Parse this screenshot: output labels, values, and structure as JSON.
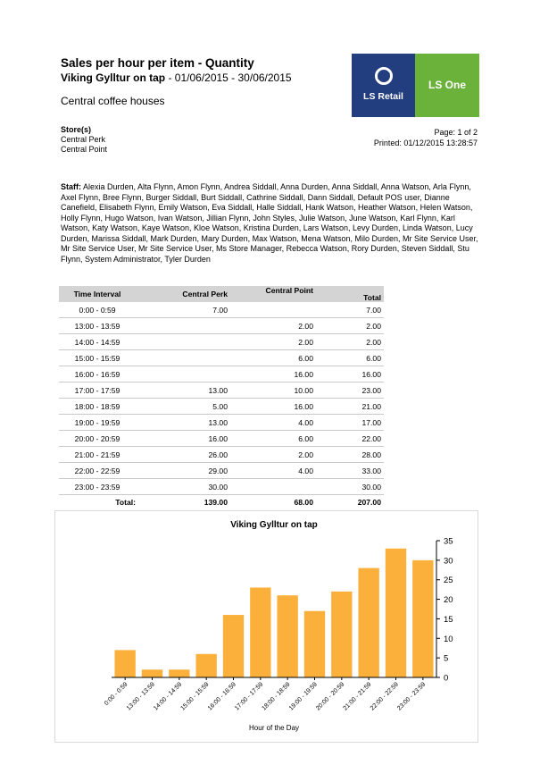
{
  "report": {
    "title": "Sales per hour per item - Quantity",
    "item": "Viking Gylltur on tap",
    "date_range": " - 01/06/2015 - 30/06/2015",
    "company": "Central coffee houses"
  },
  "logo": {
    "left_text": "LS Retail",
    "right_text": "LS One"
  },
  "stores": {
    "heading": "Store(s)",
    "items": [
      "Central Perk",
      "Central Point"
    ]
  },
  "page_info": {
    "page": "Page: 1 of 2",
    "printed": "Printed: 01/12/2015 13:28:57"
  },
  "staff": {
    "label": "Staff:",
    "text": " Alexia Durden, Alta Flynn, Amon Flynn, Andrea Siddall, Anna Durden, Anna Siddall, Anna Watson, Arla Flynn, Axel Flynn, Bree Flynn, Burger Siddall, Burt Siddall, Cathrine Siddall, Dann Siddall, Default POS user, Dianne Canefield, Elisabeth Flynn, Emily Watson, Eva Siddall, Halle Siddall, Hank Watson, Heather Watson, Helen Watson, Holly Flynn, Hugo Watson, Ivan Watson, Jillian Flynn, John Styles, Julie Watson, June Watson, Karl Flynn, Karl Watson, Katy Watson, Kaye Watson, Kloe Watson, Kristina Durden, Lars Watson, Levy Durden, Linda Watson, Lucy Durden, Marissa Siddall, Mark Durden, Mary Durden, Max Watson, Mena Watson, Milo Durden, Mr Site  Service User, Mr Site Service User, Mr Site Service User, Ms Store Manager, Rebecca Watson, Rory Durden, Steven Siddall, Stu Flynn, System Administrator, Tyler Durden"
  },
  "table": {
    "headers": [
      "Time Interval",
      "Central Perk",
      "Central Point",
      "Total"
    ],
    "rows": [
      [
        "0:00 - 0:59",
        "7.00",
        "",
        "7.00"
      ],
      [
        "13:00 - 13:59",
        "",
        "2.00",
        "2.00"
      ],
      [
        "14:00 - 14:59",
        "",
        "2.00",
        "2.00"
      ],
      [
        "15:00 - 15:59",
        "",
        "6.00",
        "6.00"
      ],
      [
        "16:00 - 16:59",
        "",
        "16.00",
        "16.00"
      ],
      [
        "17:00 - 17:59",
        "13.00",
        "10.00",
        "23.00"
      ],
      [
        "18:00 - 18:59",
        "5.00",
        "16.00",
        "21.00"
      ],
      [
        "19:00 - 19:59",
        "13.00",
        "4.00",
        "17.00"
      ],
      [
        "20:00 - 20:59",
        "16.00",
        "6.00",
        "22.00"
      ],
      [
        "21:00 - 21:59",
        "26.00",
        "2.00",
        "28.00"
      ],
      [
        "22:00 - 22:59",
        "29.00",
        "4.00",
        "33.00"
      ],
      [
        "23:00 - 23:59",
        "30.00",
        "",
        "30.00"
      ]
    ],
    "totals": [
      "Total:",
      "139.00",
      "68.00",
      "207.00"
    ]
  },
  "chart_data": {
    "type": "bar",
    "title": "Viking Gylltur on tap",
    "xlabel": "Hour of the Day",
    "ylabel": "",
    "categories": [
      "0:00 - 0:59",
      "13:00 - 13:59",
      "14:00 - 14:59",
      "15:00 - 15:59",
      "16:00 - 16:59",
      "17:00 - 17:59",
      "18:00 - 18:59",
      "19:00 - 19:59",
      "20:00 - 20:59",
      "21:00 - 21:59",
      "22:00 - 22:59",
      "23:00 - 23:59"
    ],
    "values": [
      7,
      2,
      2,
      6,
      16,
      23,
      21,
      17,
      22,
      28,
      33,
      30
    ],
    "ylim": [
      0,
      35
    ],
    "yticks": [
      0,
      5,
      10,
      15,
      20,
      25,
      30,
      35
    ],
    "y_axis_side": "right",
    "grid": false,
    "bar_color": "#fbb03b"
  }
}
